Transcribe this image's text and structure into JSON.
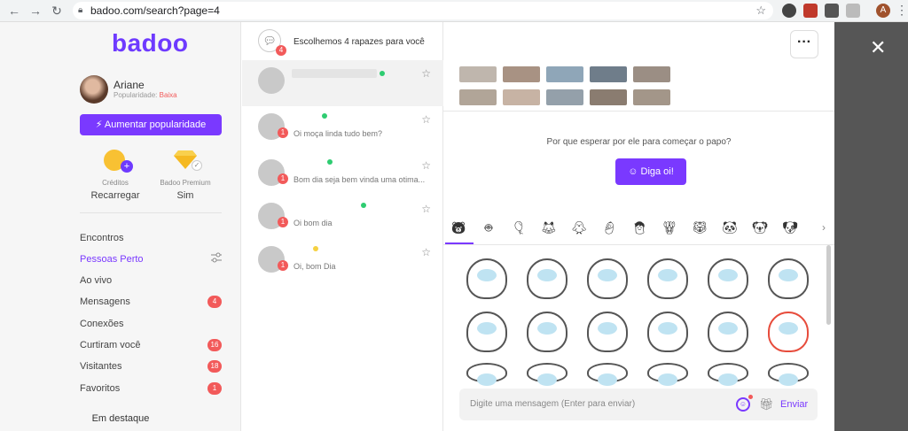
{
  "browser": {
    "url": "badoo.com/search?page=4",
    "profile_initial": "A"
  },
  "sidebar": {
    "logo": "badoo",
    "user": {
      "name": "Ariane",
      "popularity_label": "Popularidade:",
      "popularity_value": "Baixa"
    },
    "boost_button": "Aumentar popularidade",
    "credits": {
      "label": "Créditos",
      "value": "Recarregar"
    },
    "premium": {
      "label": "Badoo Premium",
      "value": "Sim"
    },
    "nav": [
      {
        "label": "Encontros",
        "count": ""
      },
      {
        "label": "Pessoas Perto",
        "count": ""
      },
      {
        "label": "Ao vivo",
        "count": ""
      },
      {
        "label": "Mensagens",
        "count": "4"
      },
      {
        "label": "Conexões",
        "count": ""
      },
      {
        "label": "Curtiram você",
        "count": "16"
      },
      {
        "label": "Visitantes",
        "count": "18"
      },
      {
        "label": "Favoritos",
        "count": "1"
      }
    ],
    "featured": "Em destaque"
  },
  "conversations": {
    "suggestion": {
      "text": "Escolhemos 4 rapazes para você",
      "count": "4"
    },
    "items": [
      {
        "message": "",
        "status_color": "#2ecc71",
        "badge": ""
      },
      {
        "message": "Oi moça linda tudo bem?",
        "status_color": "#2ecc71",
        "badge": "1"
      },
      {
        "message": "Bom dia seja bem vinda uma otima...",
        "status_color": "#2ecc71",
        "badge": "1"
      },
      {
        "message": "Oi bom dia",
        "status_color": "#2ecc71",
        "badge": "1"
      },
      {
        "message": "Oi, bom Dia",
        "status_color": "#f5d142",
        "badge": "1"
      }
    ]
  },
  "chat": {
    "prompt": "Por que esperar por ele para começar o papo?",
    "say_hi_button": "Diga oi!",
    "composer_placeholder": "Digite uma mensagem (Enter para enviar)",
    "send_button": "Enviar"
  },
  "colors": {
    "brand": "#7a39ff",
    "badge": "#f25a5a"
  }
}
